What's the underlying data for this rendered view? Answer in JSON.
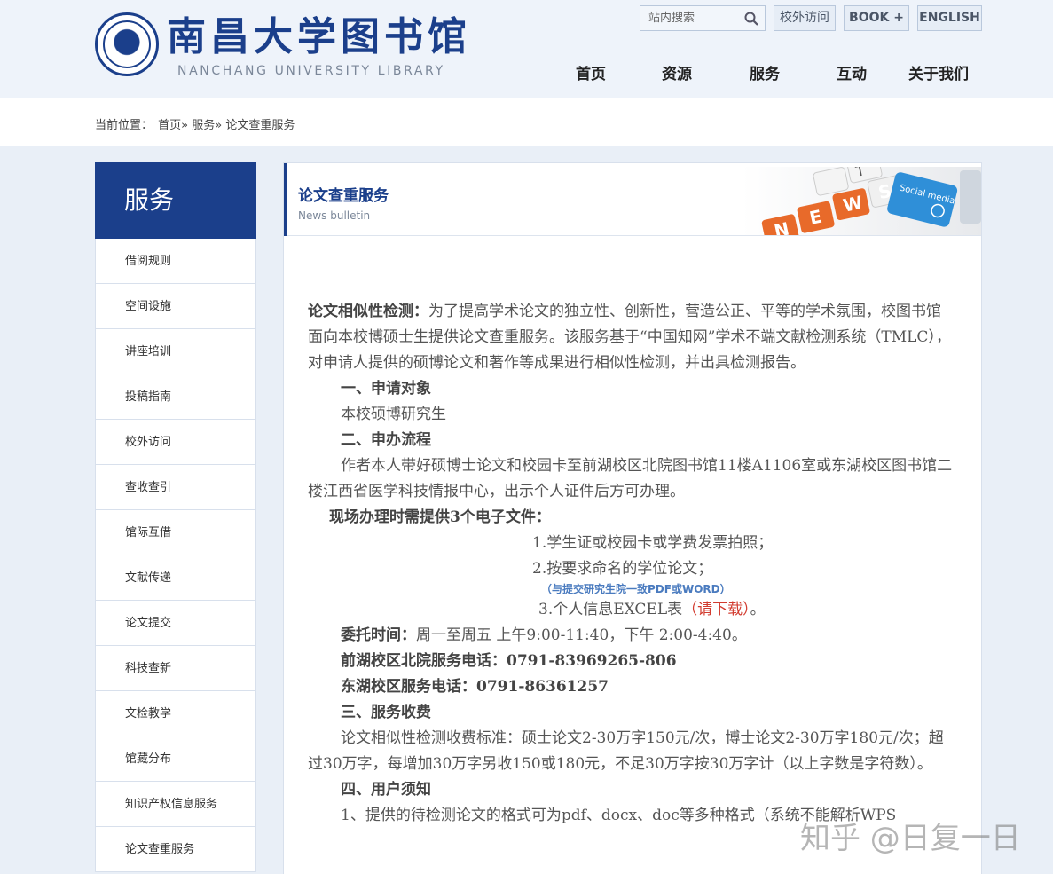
{
  "header": {
    "logo_cn": "南昌大学图书馆",
    "logo_en": "NANCHANG UNIVERSITY  LIBRARY",
    "search_placeholder": "站内搜索",
    "buttons": [
      "校外访问",
      "BOOK +",
      "ENGLISH"
    ],
    "nav": [
      "首页",
      "资源",
      "服务",
      "互动",
      "关于我们"
    ]
  },
  "breadcrumb": {
    "label": "当前位置：",
    "path": "首页» 服务» 论文查重服务"
  },
  "sidebar": {
    "title": "服务",
    "items": [
      "借阅规则",
      "空间设施",
      "讲座培训",
      "投稿指南",
      "校外访问",
      "查收查引",
      "馆际互借",
      "文献传递",
      "论文提交",
      "科技查新",
      "文检教学",
      "馆藏分布",
      "知识产权信息服务",
      "论文查重服务"
    ]
  },
  "main": {
    "title": "论文查重服务",
    "subtitle": "News bulletin",
    "banner": {
      "keys": [
        "N",
        "E",
        "W",
        "S"
      ],
      "bubble": "Social media"
    },
    "intro_label": "论文相似性检测：",
    "intro_text": "为了提高学术论文的独立性、创新性，营造公正、平等的学术氛围，校图书馆面向本校博硕士生提供论文查重服务。该服务基于“中国知网”学术不端文献检测系统（TMLC），对申请人提供的硕博论文和著作等成果进行相似性检测，并出具检测报告。",
    "sec1_title": "一、申请对象",
    "sec1_text": "本校硕博研究生",
    "sec2_title": "二、申办流程",
    "sec2_text": "作者本人带好硕博士论文和校园卡至前湖校区北院图书馆11楼A1106室或东湖校区图书馆二楼江西省医学科技情报中心，出示个人证件后方可办理。",
    "files_title": "现场办理时需提供3个电子文件：",
    "file1": "1.学生证或校园卡或学费发票拍照；",
    "file2": "2.按要求命名的学位论文；",
    "file2_note": "（与提交研究生院一致PDF或WORD）",
    "file3_prefix": "3.个人信息EXCEL表",
    "file3_link": "（请下载）",
    "file3_suffix": "。",
    "time_label": "委托时间：",
    "time_text": "周一至周五 上午9:00-11:40，下午 2:00-4:40。",
    "phone1": "前湖校区北院服务电话：0791-83969265-806",
    "phone2": "东湖校区服务电话：0791-86361257",
    "sec3_title": "三、服务收费",
    "sec3_text": "论文相似性检测收费标准：硕士论文2-30万字150元/次，博士论文2-30万字180元/次；超过30万字，每增加30万字另收150或180元，不足30万字按30万字计（以上字数是字符数）。",
    "sec4_title": "四、用户须知",
    "sec4_item1": "1、提供的待检测论文的格式可为pdf、docx、doc等多种格式（系统不能解析WPS"
  },
  "watermark": "知乎 @日复一日",
  "colors": {
    "brand": "#1b3f8b",
    "link_red": "#d23b2f",
    "note_blue": "#4a7bbf"
  }
}
